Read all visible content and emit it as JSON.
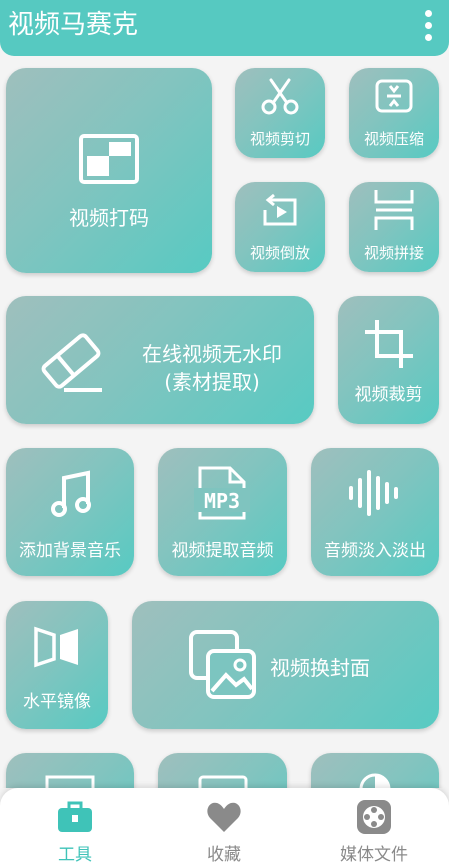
{
  "app": {
    "title": "视频马赛克"
  },
  "tiles": {
    "mosaic": "视频打码",
    "cut": "视频剪切",
    "compress": "视频压缩",
    "reverse": "视频倒放",
    "splice": "视频拼接",
    "watermark_line1": "在线视频无水印",
    "watermark_line2": "(素材提取)",
    "crop": "视频裁剪",
    "add_music": "添加背景音乐",
    "extract_audio": "视频提取音频",
    "fade": "音频淡入淡出",
    "mirror": "水平镜像",
    "cover": "视频换封面"
  },
  "icons": {
    "mp3_text": "MP3"
  },
  "nav": {
    "tools": "工具",
    "favorites": "收藏",
    "media": "媒体文件",
    "active_color": "#3fc3b8",
    "inactive_color": "#8a8a8a"
  },
  "colors": {
    "accent": "#56c9c1"
  }
}
